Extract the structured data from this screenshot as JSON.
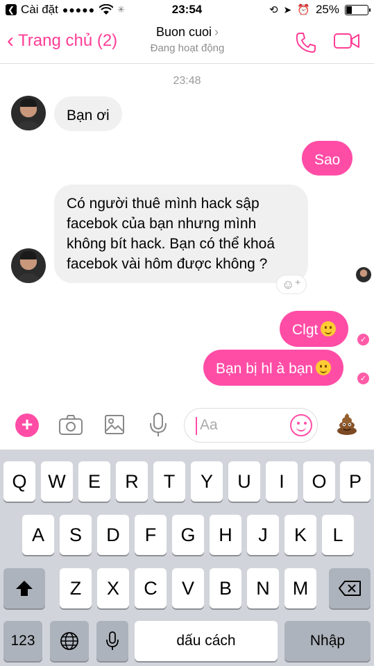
{
  "status_bar": {
    "carrier": "Cài đặt",
    "signal": "●●●●●",
    "time": "23:54",
    "battery": "25%",
    "battery_level": 0.25
  },
  "header": {
    "back_label": "Trang chủ (2)",
    "contact_name": "Buon cuoi",
    "contact_status": "Đang hoạt động",
    "accent_color": "#ff3d95"
  },
  "conversation": {
    "timestamp": "23:48",
    "messages": [
      {
        "direction": "incoming",
        "text": "Bạn ơi"
      },
      {
        "direction": "outgoing",
        "text": "Sao"
      },
      {
        "direction": "incoming",
        "lines": [
          "Có người thuê mình hack sập",
          "facebok của bạn nhưng mình",
          "không bít hack. Bạn có thể khoá",
          "facebok vài hôm được không ?"
        ]
      },
      {
        "direction": "outgoing",
        "text": "Clgt",
        "emoji": "slight-smile"
      },
      {
        "direction": "outgoing",
        "text": "Bạn bị hl à bạn",
        "emoji": "slight-smile"
      }
    ]
  },
  "composer": {
    "placeholder": "Aa",
    "icons": [
      "plus-icon",
      "camera-icon",
      "image-icon",
      "microphone-icon",
      "emoji-icon",
      "poop-emoji-icon"
    ]
  },
  "keyboard": {
    "row1": [
      "Q",
      "W",
      "E",
      "R",
      "T",
      "Y",
      "U",
      "I",
      "O",
      "P"
    ],
    "row2": [
      "A",
      "S",
      "D",
      "F",
      "G",
      "H",
      "J",
      "K",
      "L"
    ],
    "row3": [
      "Z",
      "X",
      "C",
      "V",
      "B",
      "N",
      "M"
    ],
    "numbers_label": "123",
    "space_label": "dấu cách",
    "return_label": "Nhập"
  }
}
